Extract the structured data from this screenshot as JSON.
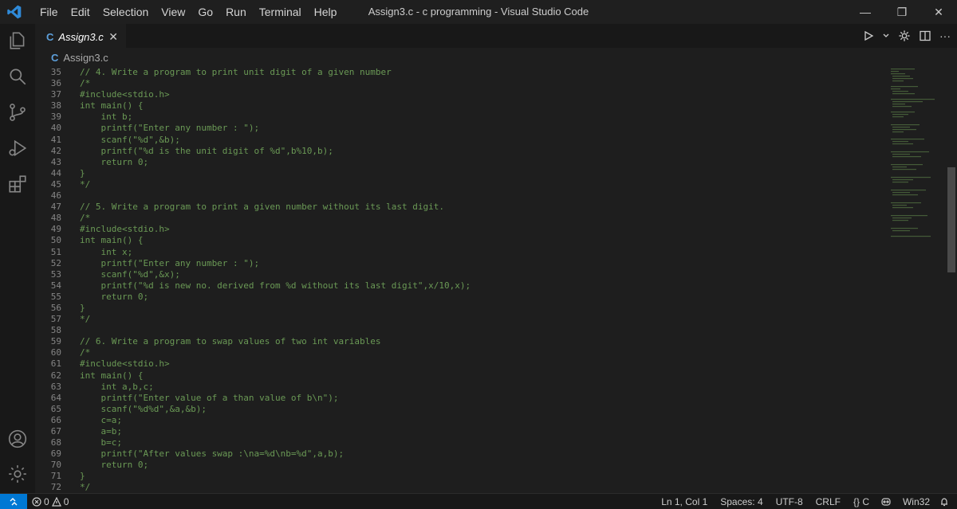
{
  "window": {
    "title": "Assign3.c - c programming - Visual Studio Code"
  },
  "menu": [
    "File",
    "Edit",
    "Selection",
    "View",
    "Go",
    "Run",
    "Terminal",
    "Help"
  ],
  "tab": {
    "lang_badge": "C",
    "name": "Assign3.c",
    "close": "✕"
  },
  "breadcrumb": {
    "lang_badge": "C",
    "file": "Assign3.c"
  },
  "editor": {
    "lines": [
      {
        "n": "35",
        "t": "// 4. Write a program to print unit digit of a given number"
      },
      {
        "n": "36",
        "t": "/*"
      },
      {
        "n": "37",
        "t": "#include<stdio.h>"
      },
      {
        "n": "38",
        "t": "int main() {"
      },
      {
        "n": "39",
        "t": "    int b;"
      },
      {
        "n": "40",
        "t": "    printf(\"Enter any number : \");"
      },
      {
        "n": "41",
        "t": "    scanf(\"%d\",&b);"
      },
      {
        "n": "42",
        "t": "    printf(\"%d is the unit digit of %d\",b%10,b);"
      },
      {
        "n": "43",
        "t": "    return 0;"
      },
      {
        "n": "44",
        "t": "}"
      },
      {
        "n": "45",
        "t": "*/"
      },
      {
        "n": "46",
        "t": ""
      },
      {
        "n": "47",
        "t": "// 5. Write a program to print a given number without its last digit."
      },
      {
        "n": "48",
        "t": "/*"
      },
      {
        "n": "49",
        "t": "#include<stdio.h>"
      },
      {
        "n": "50",
        "t": "int main() {"
      },
      {
        "n": "51",
        "t": "    int x;"
      },
      {
        "n": "52",
        "t": "    printf(\"Enter any number : \");"
      },
      {
        "n": "53",
        "t": "    scanf(\"%d\",&x);"
      },
      {
        "n": "54",
        "t": "    printf(\"%d is new no. derived from %d without its last digit\",x/10,x);"
      },
      {
        "n": "55",
        "t": "    return 0;"
      },
      {
        "n": "56",
        "t": "}"
      },
      {
        "n": "57",
        "t": "*/"
      },
      {
        "n": "58",
        "t": ""
      },
      {
        "n": "59",
        "t": "// 6. Write a program to swap values of two int variables"
      },
      {
        "n": "60",
        "t": "/*"
      },
      {
        "n": "61",
        "t": "#include<stdio.h>"
      },
      {
        "n": "62",
        "t": "int main() {"
      },
      {
        "n": "63",
        "t": "    int a,b,c;"
      },
      {
        "n": "64",
        "t": "    printf(\"Enter value of a than value of b\\n\");"
      },
      {
        "n": "65",
        "t": "    scanf(\"%d%d\",&a,&b);"
      },
      {
        "n": "66",
        "t": "    c=a;"
      },
      {
        "n": "67",
        "t": "    a=b;"
      },
      {
        "n": "68",
        "t": "    b=c;"
      },
      {
        "n": "69",
        "t": "    printf(\"After values swap :\\na=%d\\nb=%d\",a,b);"
      },
      {
        "n": "70",
        "t": "    return 0;"
      },
      {
        "n": "71",
        "t": "}"
      },
      {
        "n": "72",
        "t": "*/"
      }
    ]
  },
  "status": {
    "errors": "0",
    "warnings": "0",
    "position": "Ln 1, Col 1",
    "spaces": "Spaces: 4",
    "encoding": "UTF-8",
    "eol": "CRLF",
    "language": "{} C",
    "platform": "Win32"
  },
  "colors": {
    "comment": "#6a9955",
    "accent": "#0078d4",
    "c_badge": "#5da0dc"
  }
}
